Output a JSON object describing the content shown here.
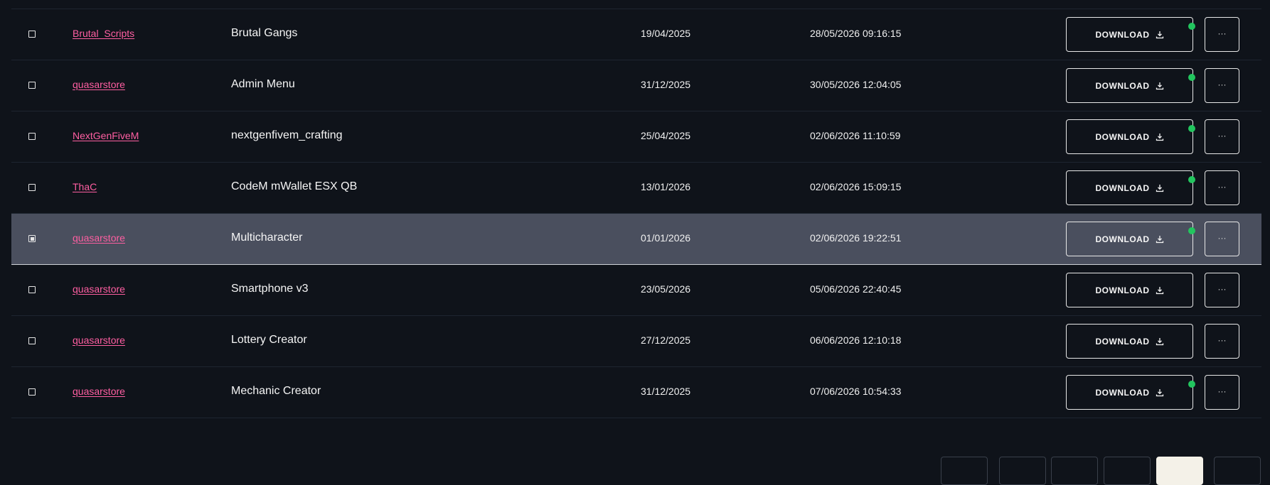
{
  "table": {
    "rows": [
      {
        "author": "Brutal_Scripts",
        "name": "Brutal Gangs",
        "date": "19/04/2025",
        "updated": "28/05/2026 09:16:15",
        "download_label": "DOWNLOAD",
        "more_label": "···",
        "has_update": true,
        "selected": false
      },
      {
        "author": "quasarstore",
        "name": "Admin Menu",
        "date": "31/12/2025",
        "updated": "30/05/2026 12:04:05",
        "download_label": "DOWNLOAD",
        "more_label": "···",
        "has_update": true,
        "selected": false
      },
      {
        "author": "NextGenFiveM",
        "name": "nextgenfivem_crafting",
        "date": "25/04/2025",
        "updated": "02/06/2026 11:10:59",
        "download_label": "DOWNLOAD",
        "more_label": "···",
        "has_update": true,
        "selected": false
      },
      {
        "author": "ThaC",
        "name": "CodeM mWallet ESX QB",
        "date": "13/01/2026",
        "updated": "02/06/2026 15:09:15",
        "download_label": "DOWNLOAD",
        "more_label": "···",
        "has_update": true,
        "selected": false
      },
      {
        "author": "quasarstore",
        "name": "Multicharacter",
        "date": "01/01/2026",
        "updated": "02/06/2026 19:22:51",
        "download_label": "DOWNLOAD",
        "more_label": "···",
        "has_update": true,
        "selected": true
      },
      {
        "author": "quasarstore",
        "name": "Smartphone v3",
        "date": "23/05/2026",
        "updated": "05/06/2026 22:40:45",
        "download_label": "DOWNLOAD",
        "more_label": "···",
        "has_update": false,
        "selected": false
      },
      {
        "author": "quasarstore",
        "name": "Lottery Creator",
        "date": "27/12/2025",
        "updated": "06/06/2026 12:10:18",
        "download_label": "DOWNLOAD",
        "more_label": "···",
        "has_update": false,
        "selected": false
      },
      {
        "author": "quasarstore",
        "name": "Mechanic Creator",
        "date": "31/12/2025",
        "updated": "07/06/2026 10:54:33",
        "download_label": "DOWNLOAD",
        "more_label": "···",
        "has_update": true,
        "selected": false
      }
    ]
  },
  "pagination": {
    "buttons": [
      {
        "active": false
      },
      {
        "active": false
      },
      {
        "active": false
      },
      {
        "active": false
      },
      {
        "active": true
      },
      {
        "active": false
      }
    ]
  },
  "colors": {
    "background": "#0f131a",
    "author_link": "#ff5fa2",
    "selected_row": "#4a4f5e",
    "status_dot": "#22c55e",
    "active_page": "#f4f1e8"
  }
}
